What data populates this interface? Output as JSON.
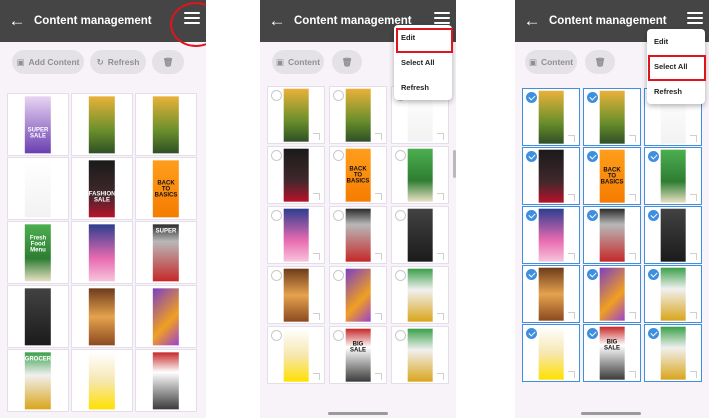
{
  "colors": {
    "appbar": "#454545",
    "highlight": "#e0141c",
    "selection": "#3f8fe0",
    "background": "#f7f3f9"
  },
  "screen1": {
    "title": "Content management",
    "back_icon": "arrow-left-icon",
    "menu_icon": "hamburger-menu-icon",
    "buttons": {
      "add_content": "Add Content",
      "refresh": "Refresh",
      "delete_icon": "trash-icon"
    },
    "items": [
      {
        "name": "super-sale-fashion",
        "caption": "SUPER SALE"
      },
      {
        "name": "monkey-tree"
      },
      {
        "name": "monkey-tree"
      },
      {
        "name": "calligraphy-poster"
      },
      {
        "name": "fashion-sale",
        "caption": "FASHION SALE"
      },
      {
        "name": "back-to-basics",
        "caption": "BACK TO BASICS"
      },
      {
        "name": "fresh-food-menu",
        "caption": "Fresh Food Menu"
      },
      {
        "name": "kirby-game"
      },
      {
        "name": "super-appliance-grid",
        "caption": "SUPER"
      },
      {
        "name": "dark-game-poster"
      },
      {
        "name": "food-menu-board"
      },
      {
        "name": "purple-game-poster"
      },
      {
        "name": "grocery-flyer",
        "caption": "GROCERY"
      },
      {
        "name": "fashion-catalog"
      },
      {
        "name": "big-sale-store"
      }
    ]
  },
  "screen2": {
    "title": "Content management",
    "buttons": {
      "content": "Content",
      "delete_icon": "trash-icon"
    },
    "menu": [
      "Edit",
      "Select All",
      "Refresh"
    ],
    "items": [
      {
        "name": "monkey-tree"
      },
      {
        "name": "monkey-tree"
      },
      {
        "name": "calligraphy-poster"
      },
      {
        "name": "fashion-sale"
      },
      {
        "name": "back-to-basics",
        "caption": "BACK TO BASICS"
      },
      {
        "name": "fresh-food-menu"
      },
      {
        "name": "kirby-game"
      },
      {
        "name": "super-appliance-grid"
      },
      {
        "name": "dark-game-poster"
      },
      {
        "name": "food-menu-board"
      },
      {
        "name": "purple-game-poster"
      },
      {
        "name": "grocery-flyer"
      },
      {
        "name": "fashion-catalog"
      },
      {
        "name": "big-sale-store",
        "caption": "BIG SALE"
      },
      {
        "name": "grocery-flyer"
      }
    ]
  },
  "screen3": {
    "title": "Content management",
    "buttons": {
      "content": "Content",
      "delete_icon": "trash-icon"
    },
    "menu": [
      "Edit",
      "Select All",
      "Refresh"
    ]
  }
}
